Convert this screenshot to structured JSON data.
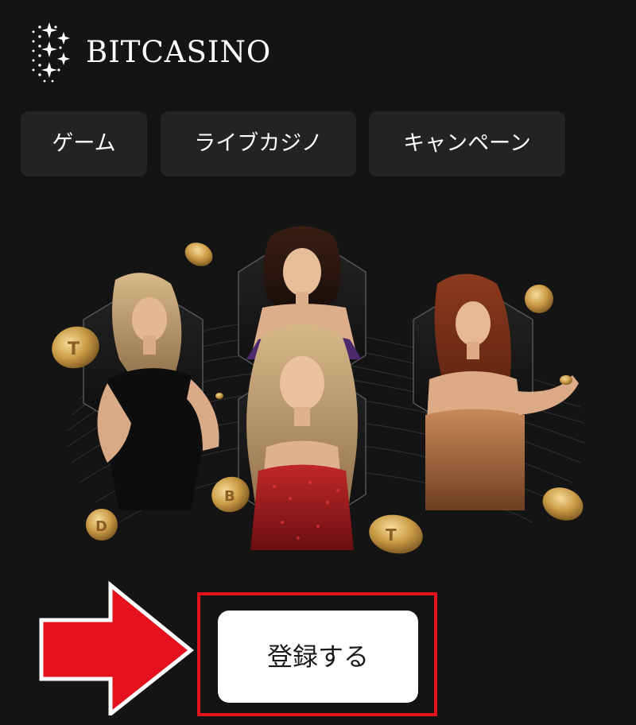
{
  "header": {
    "brand": "BITCASINO"
  },
  "nav": {
    "items": [
      {
        "label": "ゲーム"
      },
      {
        "label": "ライブカジノ"
      },
      {
        "label": "キャンペーン"
      }
    ]
  },
  "hero": {
    "image": "casino-dealers-hero"
  },
  "cta": {
    "label": "登録する"
  },
  "colors": {
    "background": "#141414",
    "nav_button": "#232323",
    "cta_background": "#ffffff",
    "highlight_red": "#e3121d",
    "coin_gold": "#c99a45"
  },
  "icons": {
    "logo": "bitcasino-star-logo-icon",
    "arrow": "red-arrow-right-icon"
  }
}
